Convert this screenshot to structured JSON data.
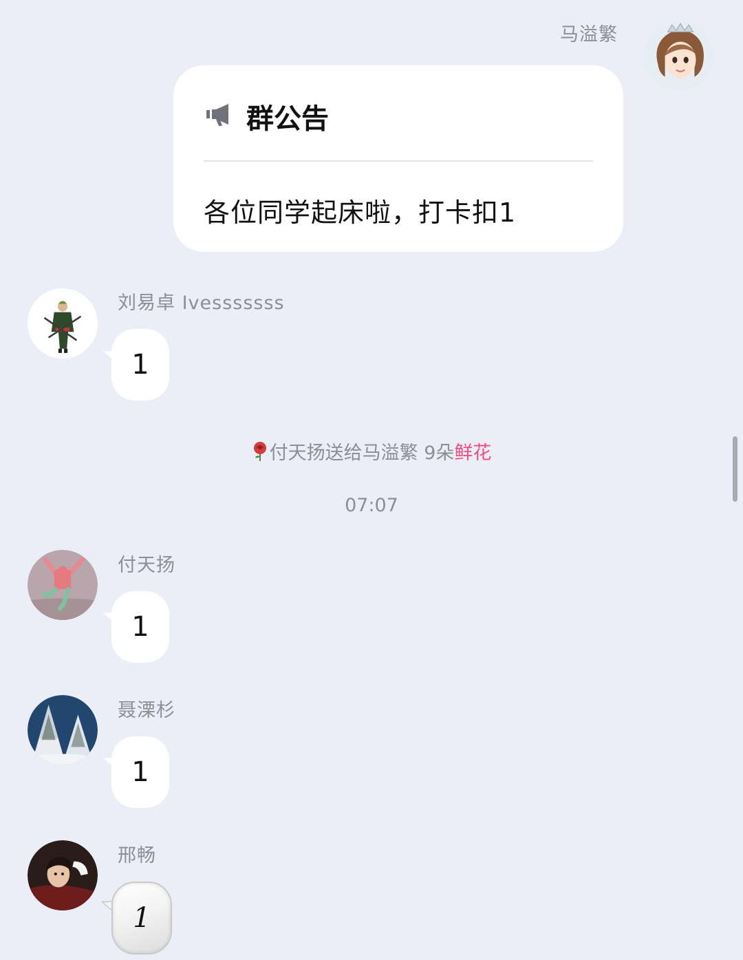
{
  "sender": {
    "name": "马溢繁"
  },
  "announcement": {
    "icon": "megaphone-icon",
    "title": "群公告",
    "body": "各位同学起床啦，打卡扣1"
  },
  "messages": [
    {
      "name": "刘易卓 Ivesssssss",
      "text": "1"
    },
    {
      "name": "付天扬",
      "text": "1"
    },
    {
      "name": "聂溧杉",
      "text": "1"
    },
    {
      "name": "邢畅",
      "text": "1"
    }
  ],
  "gift_notice": {
    "icon": "rose-icon",
    "text": "付天扬送给马溢繁 9朵",
    "highlight": "鲜花",
    "highlight_color": "#ee4d7e"
  },
  "timestamp": "07:07",
  "colors": {
    "background": "#eceef7",
    "bubble": "#ffffff",
    "meta_text": "#8d8d94"
  }
}
